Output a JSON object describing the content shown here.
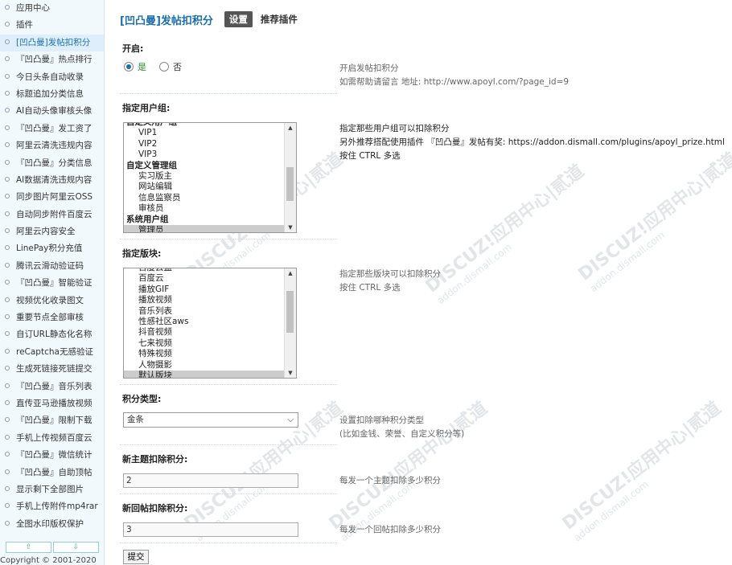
{
  "sidebar": {
    "items": [
      "应用中心",
      "插件",
      "[凹凸曼]发帖扣积分",
      "『凹凸曼』热点排行",
      "今日头条自动收录",
      "标题追加分类信息",
      "AI自动头像审核头像",
      "『凹凸曼』发工资了",
      "阿里云清洗违规内容",
      "『凹凸曼』分类信息",
      "AI数据清洗违规内容",
      "同步图片阿里云OSS",
      "自动同步附件百度云",
      "阿里云内容安全",
      "LinePay积分充值",
      "腾讯云滑动验证码",
      "『凹凸曼』智能验证",
      "视频优化收录图文",
      "重要节点全部审核",
      "自订URL静态化名称",
      "reCaptcha无感验证",
      "生成死链接死链提交",
      "『凹凸曼』音乐列表",
      "直传亚马逊播放视频",
      "『凹凸曼』限制下载",
      "手机上传视频百度云",
      "『凹凸曼』微信统计",
      "『凹凸曼』自助顶帖",
      "显示剩下全部图片",
      "手机上传附件mp4rar",
      "全图水印版权保护"
    ],
    "active_index": 2,
    "scroll_up": "⇧",
    "scroll_down": "⇩",
    "copyright": "Copyright © 2001-2020"
  },
  "header": {
    "title": "[凹凸曼]发帖扣积分",
    "tab_settings": "设置",
    "tab_recommend": "推荐插件"
  },
  "form": {
    "enable": {
      "label": "开启:",
      "yes": "是",
      "no": "否",
      "selected": "是",
      "tip1": "开启发帖扣积分",
      "tip2": "如需帮助请留言 地址: http://www.apoyl.com/?page_id=9"
    },
    "groups": {
      "label": "指定用户组:",
      "options": [
        {
          "text": "自定义用户组",
          "group": true
        },
        {
          "text": "VIP1"
        },
        {
          "text": "VIP2"
        },
        {
          "text": "VIP3"
        },
        {
          "text": "自定义管理组",
          "group": true
        },
        {
          "text": "实习版主"
        },
        {
          "text": "网站编辑"
        },
        {
          "text": "信息监察员"
        },
        {
          "text": "审核员"
        },
        {
          "text": "系统用户组",
          "group": true
        },
        {
          "text": "管理员",
          "selected": true
        }
      ],
      "tip1": "指定那些用户组可以扣除积分",
      "tip2": "另外推荐搭配使用插件 『凹凸曼』发帖有奖: https://addon.dismall.com/plugins/apoyl_prize.html",
      "tip3": "按住 CTRL 多选"
    },
    "forums": {
      "label": "指定版块:",
      "options": [
        {
          "text": "百度云盘"
        },
        {
          "text": "百度云"
        },
        {
          "text": "播放GIF"
        },
        {
          "text": "播放视频"
        },
        {
          "text": "音乐列表"
        },
        {
          "text": "性感社区aws"
        },
        {
          "text": "抖音视频"
        },
        {
          "text": "七来视频"
        },
        {
          "text": "特殊视频"
        },
        {
          "text": "人物摄影"
        },
        {
          "text": "默认版块",
          "selected": true
        }
      ],
      "tip1": "指定那些版块可以扣除积分",
      "tip2": "按住 CTRL 多选"
    },
    "credit": {
      "label": "积分类型:",
      "value": "金条",
      "tip1": "设置扣除哪种积分类型",
      "tip2": "(比如金钱、荣誉、自定义积分等)"
    },
    "new_thread": {
      "label": "新主题扣除积分:",
      "value": "2",
      "tip": "每发一个主题扣除多少积分"
    },
    "new_reply": {
      "label": "新回帖扣除积分:",
      "value": "3",
      "tip": "每发一个回帖扣除多少积分"
    },
    "submit": "提交"
  },
  "watermark": {
    "brand": "DISCUZ!应用中心|贰道",
    "domain": "addon.dismall.com"
  }
}
